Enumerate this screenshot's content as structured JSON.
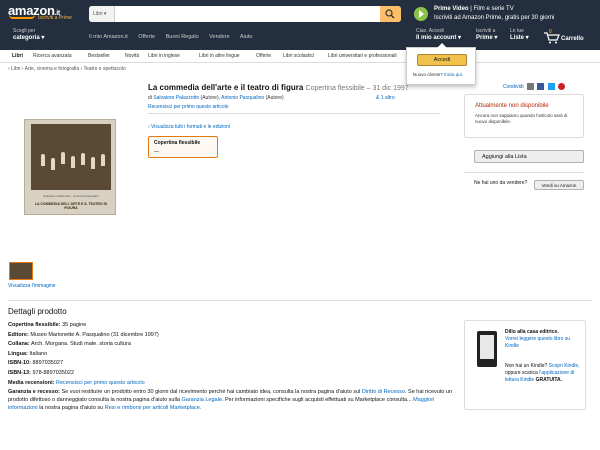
{
  "header": {
    "logo_text": "amazon",
    "logo_suffix": ".it",
    "logo_sub": "Iscriviti a Prime",
    "search_category": "Libri",
    "prime_line1_bold": "Prime Video",
    "prime_line1_rest": " | Film e serie TV",
    "prime_line2": "Iscriviti ad Amazon Prime, gratis per 30 giorni",
    "choose_small": "Scegli per",
    "choose_bold": "categoria",
    "top_links": [
      "Il mio Amazon.it",
      "Offerte",
      "Buoni Regalo",
      "Vendere",
      "Aiuto"
    ],
    "account_small": "Ciao. Accedi",
    "account_bold": "Il mio account",
    "prime_small": "Iscriviti a",
    "prime_bold": "Prime",
    "lists_small": "Le tue",
    "lists_bold": "Liste",
    "cart_count": "0",
    "cart_label": "Carrello"
  },
  "subnav": [
    "Libri",
    "Ricerca avanzata",
    "Bestseller",
    "Novità",
    "Libri in inglese",
    "Libri in altre lingue",
    "Offerte",
    "Libri scolastici",
    "Libri universitari e professionali"
  ],
  "popup": {
    "button": "Accedi",
    "new_customer": "Nuovo cliente?",
    "start_link": "Inizia qui."
  },
  "breadcrumb": "‹ Libri › Arte, cinema e fotografia › Teatro e spettacolo",
  "product": {
    "title": "La commedia dell'arte e il teatro di figura",
    "format_date": "Copertina flessibile – 31 dic 1997",
    "by": "di",
    "author1": "Salvatore Palazzotto",
    "role1": "(Autore),",
    "author2": "Antonio Pasqualino",
    "role2": "(Autore)",
    "more": "& 1 altro",
    "first_review": "Recensisci per primo questo articolo",
    "formats_link": "› Visualizza tutti i formati e le edizioni",
    "format_name": "Copertina flessibile",
    "format_price": "—",
    "cover_top": "Salvatore Palazzotto · Antonio Pasqualino",
    "cover_title": "LA COMMEDIA DELL'ARTE E IL TEATRO DI FIGURA",
    "view_image": "Visualizza l'immagine"
  },
  "side": {
    "share": "Condividi",
    "unavailable": "Attualmente non disponibile",
    "unavailable_desc": "Ancora non sappiamo quando l'articolo sarà di nuovo disponibile.",
    "add_to_list": "Aggiungi alla Lista",
    "sell_question": "Ne hai uno da vendere?",
    "sell_button": "Vendi su Amazon"
  },
  "details": {
    "heading": "Dettagli prodotto",
    "rows": [
      {
        "label": "Copertina flessibile:",
        "value": "35 pagine"
      },
      {
        "label": "Editore:",
        "value": "Museo Marionette A. Pasqualino (31 dicembre 1997)"
      },
      {
        "label": "Collana:",
        "value": "Arch. Morgana. Studi mate. storia cultura"
      },
      {
        "label": "Lingua:",
        "value": "Italiano"
      },
      {
        "label": "ISBN-10:",
        "value": "8897035027"
      },
      {
        "label": "ISBN-13:",
        "value": "978-8897035022"
      }
    ],
    "reviews_label": "Media recensioni:",
    "reviews_link": "Recensisci per primo questo articolo",
    "guarantee_label": "Garanzia e recesso:",
    "guarantee_text1": "Se vuoi restituire un prodotto entro 30 giorni dal ricevimento perché hai cambiato idea, consulta la nostra pagina d'aiuto sul",
    "guarantee_link1": "Diritto di Recesso",
    "guarantee_text2": ". Se hai ricevuto un prodotto difettoso o danneggiato consulta la nostra pagina d'aiuto sulla",
    "guarantee_link2": "Garanzia Legale",
    "guarantee_text3": ". Per informazioni specifiche sugli acquisti effettuati su Marketplace consulta...",
    "guarantee_link3": "Maggiori informazioni",
    "guarantee_text4": "la nostra pagina d'aiuto su",
    "guarantee_link4": "Resi e rimborsi per articoli Marketplace."
  },
  "kindle": {
    "title": "Dillo alla casa editrice.",
    "link": "Vorrei leggere questo libro su Kindle",
    "q1": "Non hai un Kindle?",
    "q_link": "Scopri Kindle,",
    "q2": "oppure scarica",
    "app_link": "l'applicazione di lettura Kindle",
    "free": "GRATUITA."
  },
  "colors": {
    "header_bg": "#232f3e",
    "accent": "#ff9900",
    "link": "#0066c0",
    "unavailable": "#b12704"
  }
}
